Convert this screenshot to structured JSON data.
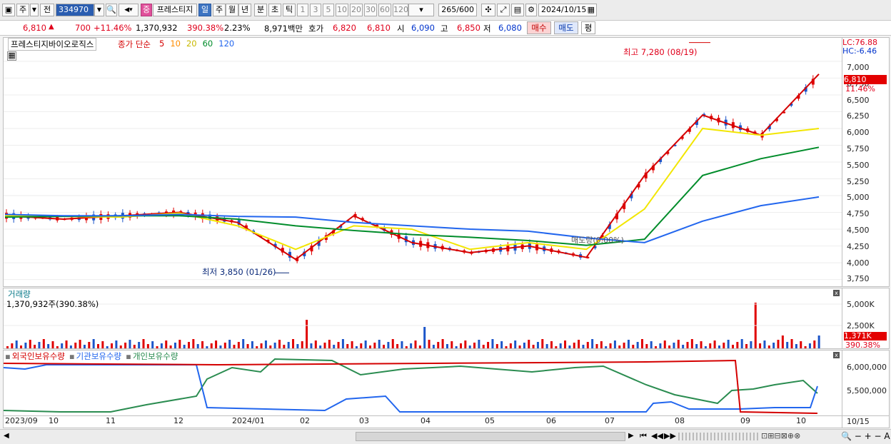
{
  "toolbar": {
    "market_selector": "주",
    "prev_label": "전",
    "stock_code": "334970",
    "badge": "중",
    "stock_name": "프레스티지",
    "periods": [
      "일",
      "주",
      "월",
      "년",
      "분",
      "초",
      "틱"
    ],
    "active_period": "일",
    "intervals": [
      "1",
      "3",
      "5",
      "10",
      "20",
      "30",
      "60",
      "120"
    ],
    "count": "265",
    "count_total": "/600",
    "date": "2024/10/15"
  },
  "quote": {
    "price": "6,810",
    "change": "700",
    "change_pct": "+11.46%",
    "volume": "1,370,932",
    "volume_ratio": "390.38%",
    "turnover": "2.23%",
    "amount": "8,971백만",
    "bid_label": "호가",
    "ask": "6,820",
    "bid": "6,810",
    "open_label": "시",
    "open": "6,090",
    "high_label": "고",
    "high": "6,850",
    "low_label": "저",
    "low": "6,080",
    "buy_label": "매수",
    "sell_label": "매도",
    "flat_label": "평"
  },
  "price_panel": {
    "stock_full_name": "프레스티지바이오로직스",
    "ma_label": "종가 단순",
    "ma_periods": [
      "5",
      "10",
      "20",
      "60",
      "120"
    ],
    "ma_colors": [
      "#d40000",
      "#ff8c00",
      "#f2e600",
      "#008c2a",
      "#2266ee"
    ],
    "lc": "LC:76.88",
    "hc": "HC:-6.46",
    "ticks": [
      "7,000",
      "6,750",
      "6,500",
      "6,250",
      "6,000",
      "5,750",
      "5,500",
      "5,250",
      "5,000",
      "4,750",
      "4,500",
      "4,250",
      "4,000",
      "3,750"
    ],
    "price_tag": "6,810",
    "pct_tag": "11.46%",
    "high_annotation": "최고 7,280 (08/19)",
    "low_annotation": "최저 3,850 (01/26)",
    "ma_annotation": "매도량(0.00%)"
  },
  "volume_panel": {
    "title": "거래량",
    "value": "1,370,932주(390.38%)",
    "ticks": [
      "5,000K",
      "2,500K"
    ],
    "tag": "1,371K",
    "tag_pct": "390.38%"
  },
  "holder_panel": {
    "series": [
      "외국인보유수량",
      "기관보유수량",
      "개인보유수량"
    ],
    "colors": [
      "#d40000",
      "#2266ee",
      "#2a8c50"
    ],
    "ticks": [
      "6,000,000",
      "5,500,000"
    ]
  },
  "x_axis": {
    "labels": [
      "2023/09",
      "10",
      "11",
      "12",
      "2024/01",
      "02",
      "03",
      "04",
      "05",
      "06",
      "07",
      "08",
      "09",
      "10"
    ],
    "right_label": "10/15"
  },
  "chart_data": {
    "type": "line",
    "x": [
      "2023/09",
      "10",
      "11",
      "12",
      "2024/01",
      "02",
      "03",
      "04",
      "05",
      "06",
      "07",
      "08",
      "09",
      "10",
      "10/15"
    ],
    "series": [
      {
        "name": "종가",
        "values": [
          4700,
          4650,
          4700,
          4750,
          4600,
          4050,
          4700,
          4300,
          4150,
          4250,
          4080,
          5300,
          6200,
          5900,
          6810
        ]
      },
      {
        "name": "20",
        "values": [
          4700,
          4690,
          4680,
          4740,
          4550,
          4200,
          4550,
          4500,
          4200,
          4300,
          4200,
          4800,
          6000,
          5900,
          6000
        ]
      },
      {
        "name": "60",
        "values": [
          4680,
          4690,
          4700,
          4700,
          4650,
          4550,
          4480,
          4420,
          4380,
          4330,
          4260,
          4350,
          5300,
          5550,
          5720
        ]
      },
      {
        "name": "120",
        "values": [
          4720,
          4700,
          4700,
          4720,
          4690,
          4680,
          4600,
          4550,
          4500,
          4470,
          4370,
          4300,
          4620,
          4850,
          4980
        ]
      }
    ],
    "ylim": [
      3650,
      7350
    ],
    "high": {
      "value": 7280,
      "date": "08/19"
    },
    "low": {
      "value": 3850,
      "date": "01/26"
    },
    "volume": {
      "last": 1370932,
      "ratio": "390.38%",
      "max_k": 5300
    }
  }
}
